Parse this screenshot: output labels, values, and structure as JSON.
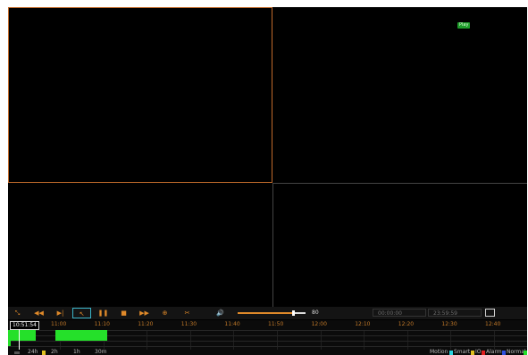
{
  "panes": {
    "top_right_badge": "Play"
  },
  "toolbar": {
    "buttons": [
      {
        "name": "split-icon",
        "glyph": "⤡"
      },
      {
        "name": "rewind-icon",
        "glyph": "◀◀"
      },
      {
        "name": "next-frame-icon",
        "glyph": "▶|"
      },
      {
        "name": "select-pointer-icon",
        "glyph": "↖"
      },
      {
        "name": "pause-icon",
        "glyph": "❚❚"
      },
      {
        "name": "stop-icon",
        "glyph": "■"
      },
      {
        "name": "fast-forward-icon",
        "glyph": "▶▶"
      },
      {
        "name": "zoom-in-icon",
        "glyph": "⊕"
      },
      {
        "name": "clip-icon",
        "glyph": "✂"
      },
      {
        "name": "volume-icon",
        "glyph": "🔊"
      }
    ],
    "volume_value": "80",
    "volume_level": 0.8,
    "start_time": "00:00:00",
    "end_time": "23:59:59"
  },
  "timeline": {
    "current_time": "10:51:54",
    "ticks": [
      "11:00",
      "11:10",
      "11:20",
      "11:30",
      "11:40",
      "11:50",
      "12:00",
      "12:10",
      "12:20",
      "12:30",
      "12:40"
    ]
  },
  "bottom": {
    "zoom_options": [
      "24h",
      "2h",
      "1h",
      "30m"
    ],
    "legend": [
      {
        "label": "Motion",
        "color": "#2ad4e0"
      },
      {
        "label": "Smart",
        "color": "#e0c020"
      },
      {
        "label": "IO",
        "color": "#e02020"
      },
      {
        "label": "Alarm",
        "color": "#3050e0"
      },
      {
        "label": "Normal",
        "color": "#25e02a"
      }
    ]
  },
  "colors": {
    "accent": "#e08a2a",
    "selected_border": "#c06a2b",
    "record": "#25e02a"
  }
}
